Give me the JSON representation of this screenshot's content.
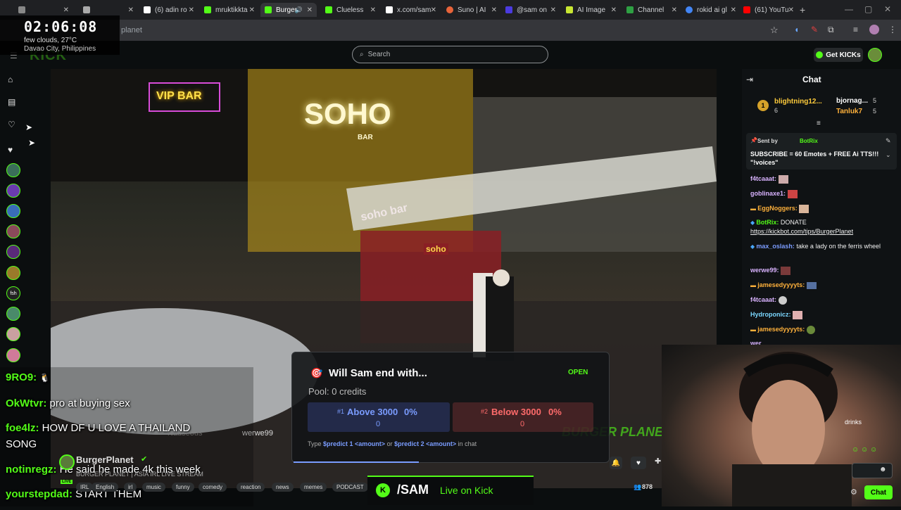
{
  "browser": {
    "tabs": [
      {
        "label": "",
        "color": "#888"
      },
      {
        "label": "",
        "color": "#aaa"
      },
      {
        "label": "(6) adin ro",
        "color": "#fff"
      },
      {
        "label": "mruktikkta",
        "color": "#53fc18"
      },
      {
        "label": "Burger",
        "color": "#53fc18"
      },
      {
        "label": "Clueless",
        "color": "#53fc18"
      },
      {
        "label": "x.com/sam",
        "color": "#fff"
      },
      {
        "label": "Suno | AI",
        "color": "#e8643a"
      },
      {
        "label": "@sam on",
        "color": "#4b3be0"
      },
      {
        "label": "AI Image",
        "color": "#c8e632"
      },
      {
        "label": "Channel",
        "color": "#2ea043"
      },
      {
        "label": "rokid ai gl",
        "color": "#4285f4"
      },
      {
        "label": "(61) YouTu",
        "color": "#ff0000"
      }
    ],
    "url": "planet"
  },
  "clock": {
    "time": "02:06:08",
    "weather": "few clouds, 27°C",
    "location": "Davao City, Philippines"
  },
  "header": {
    "logo": "KICK",
    "search_placeholder": "Search",
    "get_kicks_label": "Get KICKs"
  },
  "chat": {
    "title": "Chat",
    "leaderboard": {
      "first": {
        "rank": "1",
        "name": "blightning12...",
        "count": "6"
      },
      "second": {
        "name": "bjornag...",
        "count": "5"
      },
      "third": {
        "name": "Tanluk7",
        "count": "5"
      }
    },
    "pinned": {
      "sent_by_label": "Sent by",
      "sender": "BotRix",
      "text": "SUBSCRIBE = 60 Emotes + FREE Ai TTS!!! \"!voices\""
    },
    "messages": [
      {
        "user": "f4tcaaat:",
        "text": "",
        "color": "#d9b3ff"
      },
      {
        "user": "goblinaxe1:",
        "text": "",
        "color": "#d9b3ff"
      },
      {
        "user": "EggNoggers:",
        "text": "",
        "color": "#ffb13b"
      },
      {
        "user": "BotRix:",
        "text": "DONATE",
        "color": "#53fc18"
      },
      {
        "user": "",
        "text": "https://kickbot.com/tips/BurgerPlanet",
        "color": "#fff"
      },
      {
        "user": "max_oslash:",
        "text": "take a lady on the ferris wheel",
        "color": "#7b9cff"
      },
      {
        "user": "werwe99:",
        "text": "",
        "color": "#d9b3ff"
      },
      {
        "user": "jamesedyyyyts:",
        "text": "",
        "color": "#ffb13b"
      },
      {
        "user": "f4tcaaat:",
        "text": "",
        "color": "#d9b3ff"
      },
      {
        "user": "Hydroponicz:",
        "text": "",
        "color": "#7bd7ff"
      },
      {
        "user": "jamesedyyyyts:",
        "text": "",
        "color": "#ffb13b"
      },
      {
        "user": "wer",
        "text": "",
        "color": "#d9b3ff"
      }
    ],
    "partial_text": "drinks",
    "chat_button": "Chat"
  },
  "overlay_chat": [
    {
      "user": "9RO9:",
      "text": ""
    },
    {
      "user": "OkWtvr:",
      "text": " pro at buying sex"
    },
    {
      "user": "foe4lz:",
      "text": " HOW DF U LOVE A THAILAND"
    },
    {
      "user": "",
      "text": "SONG"
    },
    {
      "user": "notinregz:",
      "text": " He said he made 4k this week"
    },
    {
      "user": "yourstepdad:",
      "text": " START THEM"
    }
  ],
  "stream_signs": {
    "vip_bar": "VIP BAR",
    "soho": "SOHO",
    "soho_small": "BAR",
    "soho_bar": "soho bar",
    "soho_sign": "soho",
    "burger_planet": "BURGER PLANET",
    "werwe99": "werwe99",
    "nauseous": "Nauseous"
  },
  "prediction": {
    "question": "Will Sam end with...",
    "status": "OPEN",
    "pool": "Pool: 0 credits",
    "option1": {
      "num": "#1",
      "label": "Above 3000",
      "pct": "0%",
      "count": "0"
    },
    "option2": {
      "num": "#2",
      "label": "Below 3000",
      "pct": "0%",
      "count": "0"
    },
    "instructions_prefix": "Type",
    "cmd1": "$predict 1 <amount>",
    "or": "or",
    "cmd2": "$predict 2 <amount>",
    "instructions_suffix": "in chat"
  },
  "streamer": {
    "name": "BurgerPlanet",
    "title": "BURGER PLANET | ASIA IRL LIVE STREAM",
    "live": "LIVE",
    "viewers": "878",
    "tags": [
      "IRL",
      "English",
      "irl",
      "music",
      "funny",
      "comedy",
      "reaction",
      "news",
      "memes",
      "PODCAST"
    ]
  },
  "live_banner": {
    "badge": "K",
    "channel": "/SAM",
    "text": "Live on Kick"
  },
  "colors": {
    "kick_green": "#53fc18",
    "option1_blue": "#7a9cff",
    "option2_red": "#ff6b6b"
  }
}
